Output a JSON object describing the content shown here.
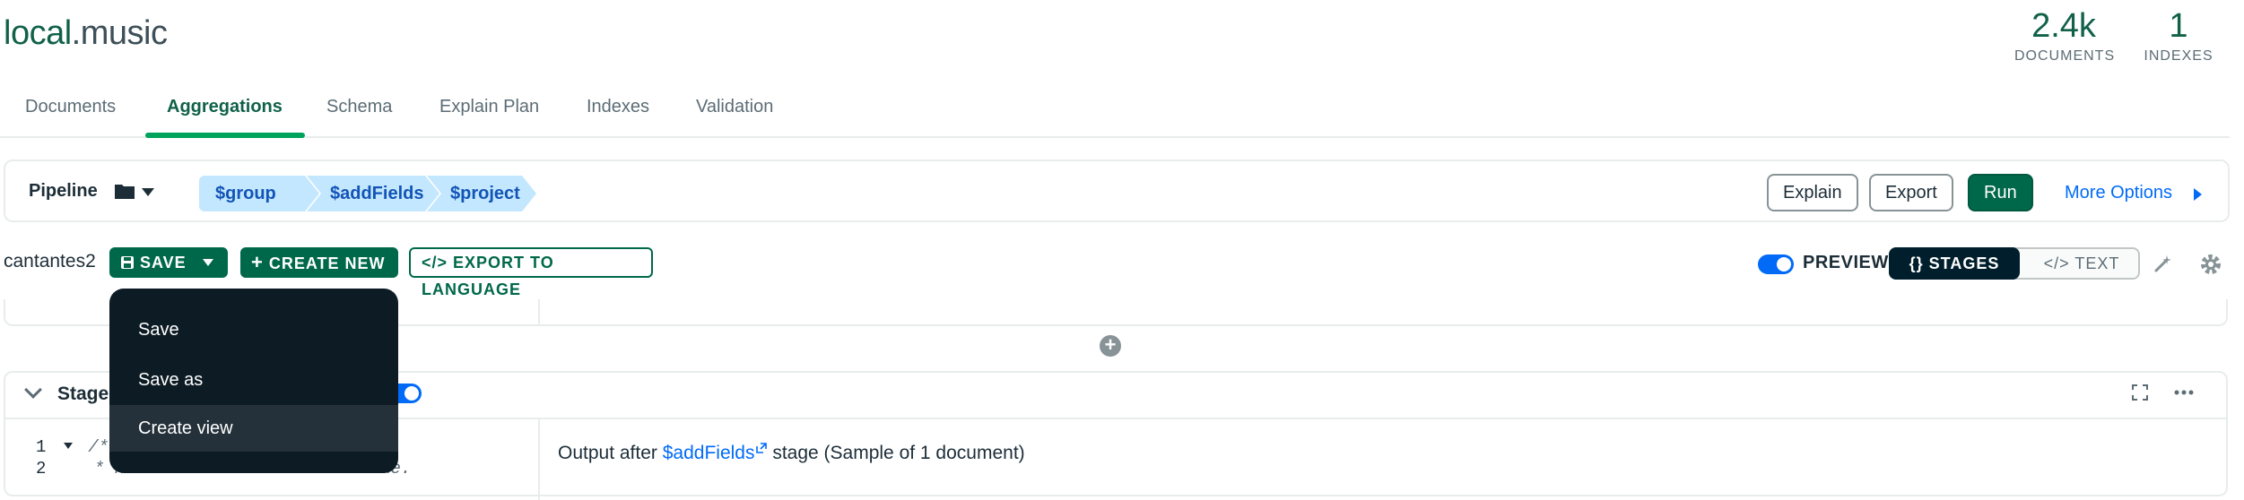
{
  "header": {
    "db": "local",
    "coll": ".music",
    "stats": [
      {
        "value": "2.4k",
        "label": "DOCUMENTS"
      },
      {
        "value": "1",
        "label": "INDEXES"
      }
    ]
  },
  "tabs": [
    "Documents",
    "Aggregations",
    "Schema",
    "Explain Plan",
    "Indexes",
    "Validation"
  ],
  "active_tab": "Aggregations",
  "pipeline_bar": {
    "label": "Pipeline",
    "stages": [
      "$group",
      "$addFields",
      "$project"
    ],
    "explain": "Explain",
    "export": "Export",
    "run": "Run",
    "more_options": "More Options"
  },
  "saved_row": {
    "name": "cantantes2",
    "save": "SAVE",
    "create_new": "CREATE NEW",
    "export_to_language": "EXPORT TO LANGUAGE",
    "preview": "PREVIEW",
    "stages_mode": "STAGES",
    "text_mode": "TEXT",
    "stages_prefix": "{}",
    "text_prefix": "</>",
    "export_prefix": "</>"
  },
  "stage_card": {
    "label": "Stage",
    "line1_num": "1",
    "line1_code": "/**",
    "line2_num": "2",
    "line2_code": "* newField: The new field name.",
    "output_prefix": "Output after",
    "output_link": "$addFields",
    "output_suffix": "stage (Sample of 1 document)"
  },
  "save_menu": {
    "items": [
      "Save",
      "Save as",
      "Create view"
    ],
    "highlighted": "Create view"
  },
  "colors": {
    "brand_green": "#00684a",
    "chip_blue": "#c3e7fe",
    "link_blue": "#016bf8",
    "menu_bg": "#0d1b24"
  }
}
